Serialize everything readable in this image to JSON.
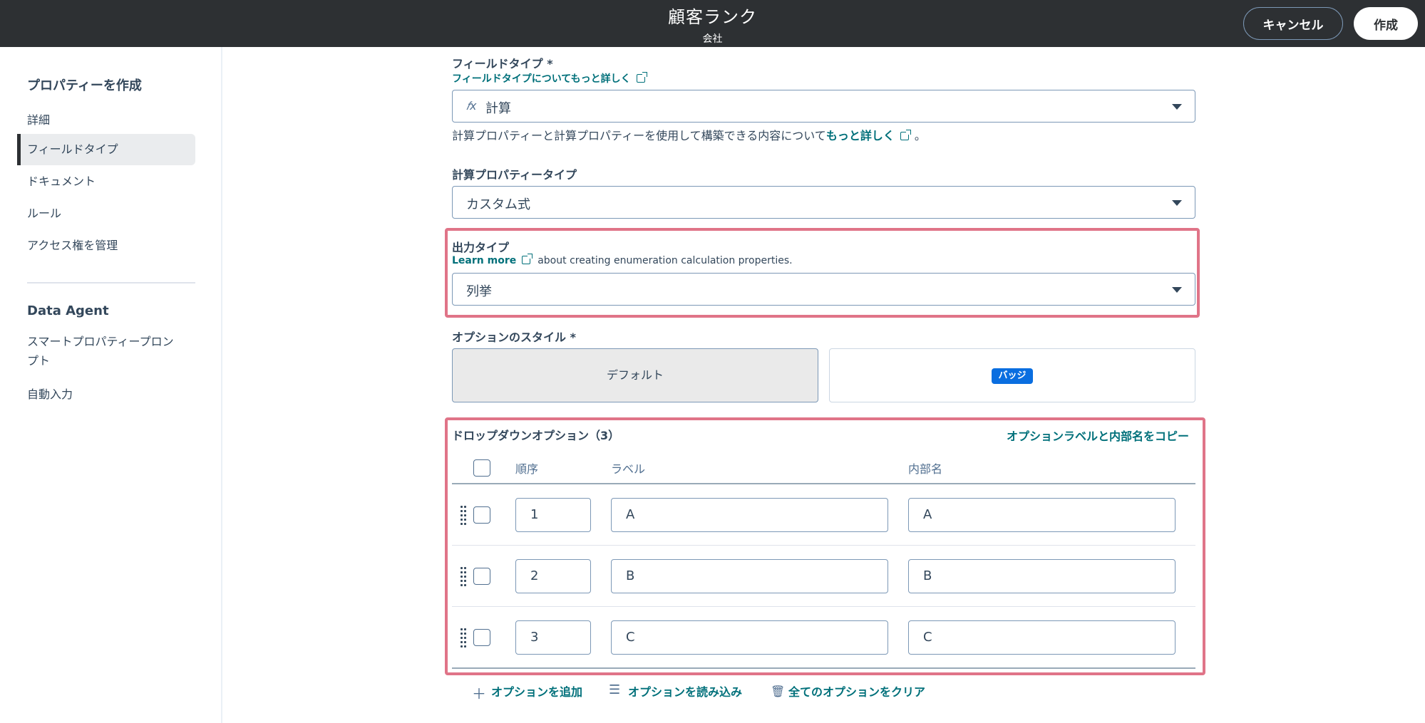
{
  "header": {
    "title": "顧客ランク",
    "subtitle": "会社",
    "cancel_label": "キャンセル",
    "create_label": "作成"
  },
  "sidebar": {
    "title": "プロパティーを作成",
    "items": [
      {
        "label": "詳細",
        "active": false
      },
      {
        "label": "フィールドタイプ",
        "active": true
      },
      {
        "label": "ドキュメント",
        "active": false
      },
      {
        "label": "ルール",
        "active": false
      },
      {
        "label": "アクセス権を管理",
        "active": false
      }
    ],
    "section_title": "Data Agent",
    "section_items": [
      {
        "label": "スマートプロパティープロンプト"
      },
      {
        "label": "自動入力"
      }
    ]
  },
  "field_type": {
    "label": "フィールドタイプ *",
    "learn_link": "フィールドタイプについてもっと詳しく",
    "value_icon": "𝑓x",
    "value": "計算",
    "help_prefix": "計算プロパティーと計算プロパティーを使用して構築できる内容について",
    "help_link": "もっと詳しく",
    "help_suffix": "。"
  },
  "calc_type": {
    "label": "計算プロパティータイプ",
    "value": "カスタム式"
  },
  "output_type": {
    "label": "出力タイプ",
    "learn_link": "Learn more",
    "help_text": "about creating enumeration calculation properties.",
    "value": "列挙"
  },
  "option_style": {
    "label": "オプションのスタイル *",
    "default_label": "デフォルト",
    "badge_label": "バッジ",
    "selected": "default"
  },
  "dropdown_options": {
    "title": "ドロップダウンオプション（3）",
    "copy_link": "オプションラベルと内部名をコピー",
    "columns": [
      "順序",
      "ラベル",
      "内部名"
    ],
    "rows": [
      {
        "order": "1",
        "label": "A",
        "internal": "A"
      },
      {
        "order": "2",
        "label": "B",
        "internal": "B"
      },
      {
        "order": "3",
        "label": "C",
        "internal": "C"
      }
    ]
  },
  "actions": {
    "add": "オプションを追加",
    "load": "オプションを読み込み",
    "clear": "全てのオプションをクリア"
  },
  "colors": {
    "header_bg": "#2d3033",
    "link": "#00707a",
    "highlight": "#e07488",
    "badge": "#0a6ee0"
  }
}
